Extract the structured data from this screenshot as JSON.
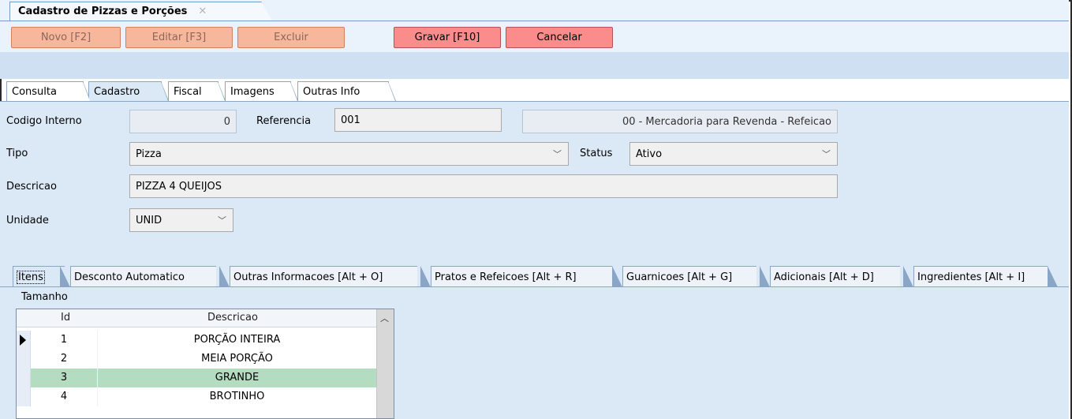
{
  "window": {
    "tab_title": "Cadastro de Pizzas e Porções",
    "close_glyph": "✕"
  },
  "toolbar": {
    "novo": "Novo [F2]",
    "editar": "Editar [F3]",
    "excluir": "Excluir",
    "gravar": "Gravar [F10]",
    "cancelar": "Cancelar"
  },
  "main_tabs": [
    "Consulta",
    "Cadastro",
    "Fiscal",
    "Imagens",
    "Outras Info"
  ],
  "form": {
    "codigo_label": "Codigo Interno",
    "codigo_value": "0",
    "referencia_label": "Referencia",
    "referencia_value": "001",
    "tipo_fiscal_value": "00 - Mercadoria para Revenda - Refeicao",
    "tipo_label": "Tipo",
    "tipo_value": "Pizza",
    "status_label": "Status",
    "status_value": "Ativo",
    "descricao_label": "Descricao",
    "descricao_value": "PIZZA 4 QUEIJOS",
    "unidade_label": "Unidade",
    "unidade_value": "UNID"
  },
  "sub_tabs": [
    "Itens",
    "Desconto Automatico",
    "Outras Informacoes [Alt + O]",
    "Pratos e Refeicoes [Alt + R]",
    "Guarnicoes [Alt + G]",
    "Adicionais [Alt + D]",
    "Ingredientes [Alt + I]"
  ],
  "section_label": "Tamanho",
  "grid": {
    "columns": [
      "Id",
      "Descricao"
    ],
    "rows": [
      {
        "id": "1",
        "descricao": "PORÇÃO INTEIRA"
      },
      {
        "id": "2",
        "descricao": "MEIA PORÇÃO"
      },
      {
        "id": "3",
        "descricao": "GRANDE"
      },
      {
        "id": "4",
        "descricao": "BROTINHO"
      }
    ]
  },
  "colors": {
    "accent_button": "#fa8c8c",
    "disabled_button": "#f6b79c",
    "panel": "#dbe8f6",
    "row_highlight": "#b4dcc0"
  }
}
